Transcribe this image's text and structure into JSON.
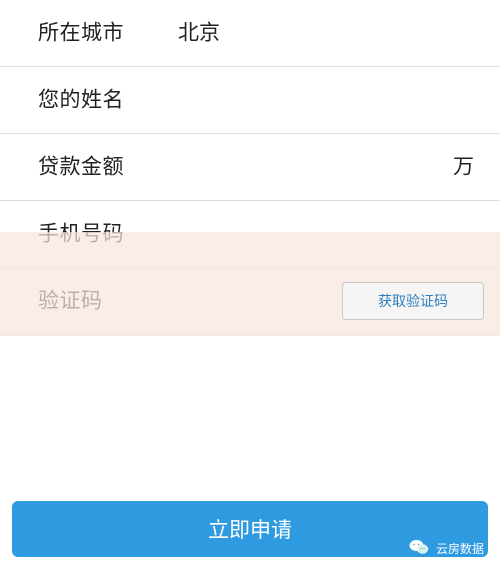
{
  "form": {
    "rows": [
      {
        "label": "所在城市",
        "value": "北京"
      },
      {
        "label": "您的姓名",
        "value": ""
      },
      {
        "label": "贷款金额",
        "unit": "万"
      },
      {
        "label": "手机号码"
      },
      {
        "label": "验证码",
        "button_label": "获取验证码"
      }
    ]
  },
  "submit": {
    "label": "立即申请"
  },
  "watermark": {
    "text": "云房数据",
    "icon": "wechat-icon"
  }
}
